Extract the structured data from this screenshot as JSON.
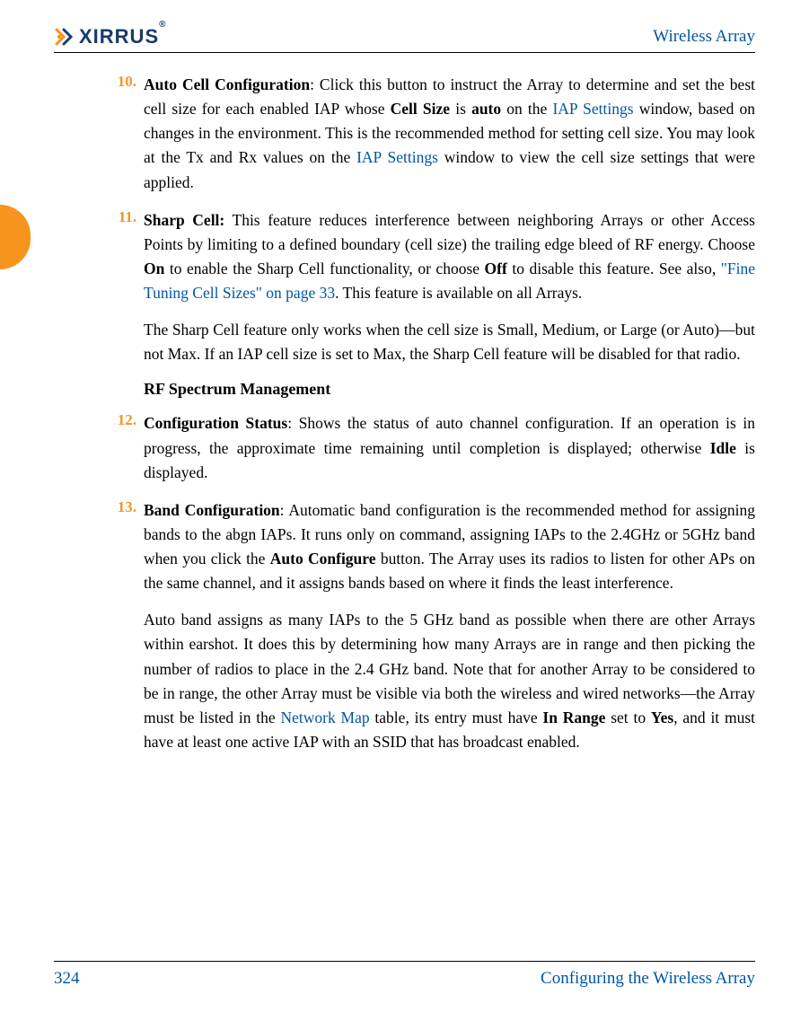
{
  "header": {
    "logo_text": "XIRRUS",
    "title": "Wireless Array"
  },
  "items": {
    "n10": {
      "num": "10.",
      "title": "Auto Cell Configuration",
      "text_a": ": Click this button to instruct the Array to determine and set the best cell size for each enabled IAP whose ",
      "bold_a": "Cell Size",
      "text_b": " is ",
      "bold_b": "auto",
      "text_c": " on the ",
      "link_a": "IAP Settings",
      "text_d": " window, based on changes in the environment. This is the recommended method for setting cell size. You may look at the Tx and Rx values on the ",
      "link_b": "IAP Settings",
      "text_e": " window to view the cell size settings that were applied."
    },
    "n11": {
      "num": "11.",
      "title": "Sharp Cell:",
      "text_a": " This feature reduces interference between neighboring Arrays or other Access Points by limiting to a defined boundary (cell size) the trailing edge bleed of RF energy. Choose ",
      "bold_a": "On",
      "text_b": " to enable the Sharp Cell functionality, or choose ",
      "bold_b": "Off",
      "text_c": " to disable this feature. See also, ",
      "link_a": "\"Fine Tuning Cell Sizes\" on page 33",
      "text_d": ". This feature is available on all Arrays.",
      "para2": "The Sharp Cell feature only works when the cell size is Small, Medium, or Large (or Auto)—but not Max. If an IAP cell size is set to Max, the Sharp Cell feature will be disabled for that radio."
    },
    "n12": {
      "num": "12.",
      "title": "Configuration Status",
      "text_a": ": Shows the status of auto channel configuration. If an operation is in progress, the approximate time remaining until completion is displayed; otherwise ",
      "bold_a": "Idle",
      "text_b": " is displayed."
    },
    "n13": {
      "num": "13.",
      "title": "Band Configuration",
      "text_a": ": Automatic band configuration is the recommended method for assigning bands to the abgn IAPs. It runs only on command, assigning IAPs to the 2.4GHz or 5GHz band when you click the ",
      "bold_a": "Auto Configure",
      "text_b": " button. The Array uses its radios to listen for other APs on the same channel, and it assigns bands based on where it finds the least interference.",
      "para2_a": "Auto band assigns as many IAPs to the 5 GHz band as possible when there are other Arrays within earshot. It does this by determining how many Arrays are in range and then picking the number of radios to place in the 2.4 GHz band. Note that for another Array to be considered to be in range, the other Array must be visible via both the wireless and wired networks—the Array must be listed in the ",
      "para2_link": "Network Map",
      "para2_b": " table, its entry must have ",
      "para2_bold1": "In Range",
      "para2_c": " set to ",
      "para2_bold2": "Yes",
      "para2_d": ", and it must have at least one active IAP with an SSID that has broadcast enabled."
    }
  },
  "section_heading": "RF Spectrum Management",
  "footer": {
    "page": "324",
    "title": "Configuring the Wireless Array"
  }
}
